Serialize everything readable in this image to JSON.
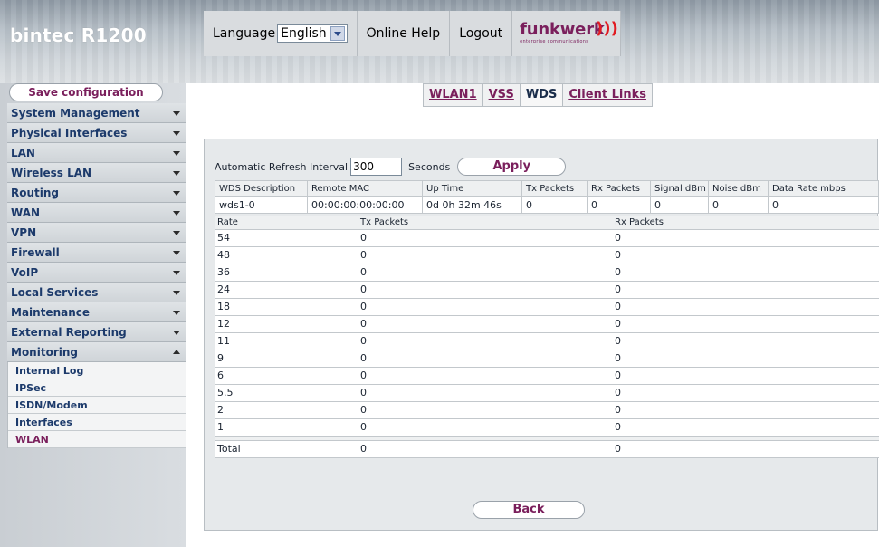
{
  "header": {
    "brand": "bintec R1200",
    "language_label": "Language",
    "language_value": "English",
    "online_help": "Online Help",
    "logout": "Logout",
    "logo_word": "funkwerk",
    "logo_tag": "enterprise communications",
    "logo_waves": ")))"
  },
  "sidebar": {
    "save_label": "Save configuration",
    "items": [
      {
        "label": "System Management"
      },
      {
        "label": "Physical Interfaces"
      },
      {
        "label": "LAN"
      },
      {
        "label": "Wireless LAN"
      },
      {
        "label": "Routing"
      },
      {
        "label": "WAN"
      },
      {
        "label": "VPN"
      },
      {
        "label": "Firewall"
      },
      {
        "label": "VoIP"
      },
      {
        "label": "Local Services"
      },
      {
        "label": "Maintenance"
      },
      {
        "label": "External Reporting"
      },
      {
        "label": "Monitoring"
      }
    ],
    "sub_items": [
      {
        "label": "Internal Log"
      },
      {
        "label": "IPSec"
      },
      {
        "label": "ISDN/Modem"
      },
      {
        "label": "Interfaces"
      },
      {
        "label": "WLAN"
      }
    ]
  },
  "tabs": [
    {
      "label": "WLAN1"
    },
    {
      "label": "VSS"
    },
    {
      "label": "WDS"
    },
    {
      "label": "Client Links"
    }
  ],
  "refresh": {
    "label": "Automatic Refresh Interval",
    "value": "300",
    "unit": "Seconds",
    "apply": "Apply"
  },
  "wds_table": {
    "headers": [
      "WDS Description",
      "Remote MAC",
      "Up Time",
      "Tx Packets",
      "Rx Packets",
      "Signal dBm",
      "Noise dBm",
      "Data Rate mbps"
    ],
    "row": [
      "wds1-0",
      "00:00:00:00:00:00",
      "0d 0h 32m 46s",
      "0",
      "0",
      "0",
      "0",
      "0"
    ]
  },
  "rate_table": {
    "headers": [
      "Rate",
      "Tx Packets",
      "Rx Packets"
    ],
    "rows": [
      [
        "54",
        "0",
        "0"
      ],
      [
        "48",
        "0",
        "0"
      ],
      [
        "36",
        "0",
        "0"
      ],
      [
        "24",
        "0",
        "0"
      ],
      [
        "18",
        "0",
        "0"
      ],
      [
        "12",
        "0",
        "0"
      ],
      [
        "11",
        "0",
        "0"
      ],
      [
        "9",
        "0",
        "0"
      ],
      [
        "6",
        "0",
        "0"
      ],
      [
        "5.5",
        "0",
        "0"
      ],
      [
        "2",
        "0",
        "0"
      ],
      [
        "1",
        "0",
        "0"
      ]
    ],
    "total": [
      "Total",
      "0",
      "0"
    ]
  },
  "back_label": "Back",
  "colors": {
    "accent": "#7a1f5c",
    "nav_text": "#1c3a6b"
  }
}
